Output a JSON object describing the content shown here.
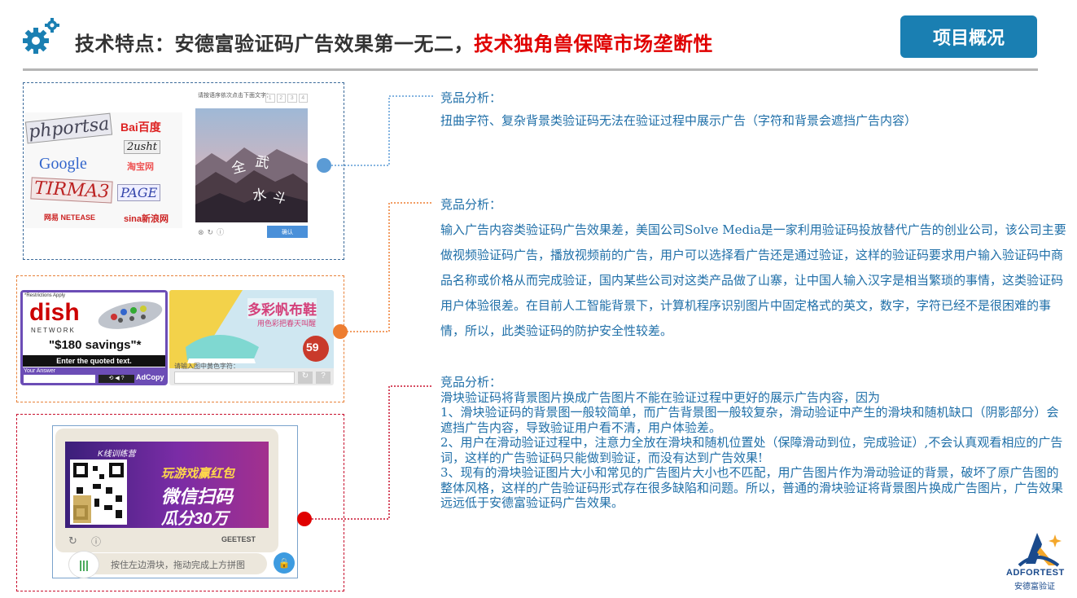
{
  "header": {
    "title_black": "技术特点：安德富验证码广告效果第一无二，",
    "title_red": "技术独角兽保障市场垄断性",
    "overview_button": "项目概况"
  },
  "section1": {
    "label": "竞品分析：",
    "text": "扭曲字符、复杂背景类验证码无法在验证过程中展示广告（字符和背景会遮挡广告内容）",
    "captcha_hint": "请按语序依次点击下面文字：",
    "hint_boxes": [
      "1",
      "2",
      "3",
      "4"
    ],
    "confirm_label": "确认",
    "collage_words": [
      "phportsa",
      "Bai百度",
      "Google",
      "2usht",
      "淘宝网",
      "TIRMA3",
      "PAGE",
      "网易 NETEASE",
      "sina新浪网"
    ],
    "image_chars": [
      "全",
      "武",
      "水",
      "斗"
    ]
  },
  "section2": {
    "label": "竞品分析：",
    "paragraph": "输入广告内容类验证码广告效果差，美国公司Solve Media是一家利用验证码投放替代广告的创业公司，该公司主要做视频验证码广告，播放视频前的广告，用户可以选择看广告还是通过验证，这样的验证码要求用户输入验证码中商品名称或价格从而完成验证，国内某些公司对这类产品做了山寨，让中国人输入汉字是相当繁琐的事情，这类验证码用户体验很差。在目前人工智能背景下，计算机程序识别图片中固定格式的英文，数字，字符已经不是很困难的事情，所以，此类验证码的防护安全性较差。",
    "dish": {
      "restriction": "*Restrictions Apply",
      "brand": "dish",
      "network": "NETWORK",
      "savings": "\"$180 savings\"*",
      "instruction": "Enter the quoted text.",
      "answer_label": "Your Answer",
      "adcopy": "AdCopy"
    },
    "shoe": {
      "headline": "多彩帆布鞋",
      "subline": "用色彩把春天叫醒",
      "price": "59",
      "prompt": "请输入图中黄色字符："
    }
  },
  "section3": {
    "label": "竞品分析：",
    "lines": [
      "滑块验证码将背景图片换成广告图片不能在验证过程中更好的展示广告内容，因为",
      "1、滑块验证码的背景图一般较简单，而广告背景图一般较复杂，滑动验证中产生的滑块和随机缺口（阴影部分）会遮挡广告内容，导致验证用户看不清，用户体验差。",
      "2、用户在滑动验证过程中，注意力全放在滑块和随机位置处（保障滑动到位，完成验证）,不会认真观看相应的广告词，这样的广告验证码只能做到验证，而没有达到广告效果!",
      "3、现有的滑块验证图片大小和常见的广告图片大小也不匹配，用广告图片作为滑动验证的背景，破坏了原广告图的整体风格，这样的广告验证码形式存在很多缺陷和问题。所以，普通的滑块验证将背景图片换成广告图片，广告效果远远低于安德富验证码广告效果。"
    ],
    "ad_tag": "K线训练营",
    "ad_line1": "玩游戏赢红包",
    "ad_line2": "微信扫码",
    "ad_line3": "瓜分30万",
    "geetest": "GEETEST",
    "slider_text": "按住左边滑块，拖动完成上方拼图"
  },
  "logo": {
    "name": "ADFORTEST",
    "sub": "安德富验证"
  },
  "colors": {
    "accent_blue": "#1a7fb2",
    "text_blue": "#1f6fa8",
    "red": "#e00000",
    "orange": "#ed7d31"
  }
}
